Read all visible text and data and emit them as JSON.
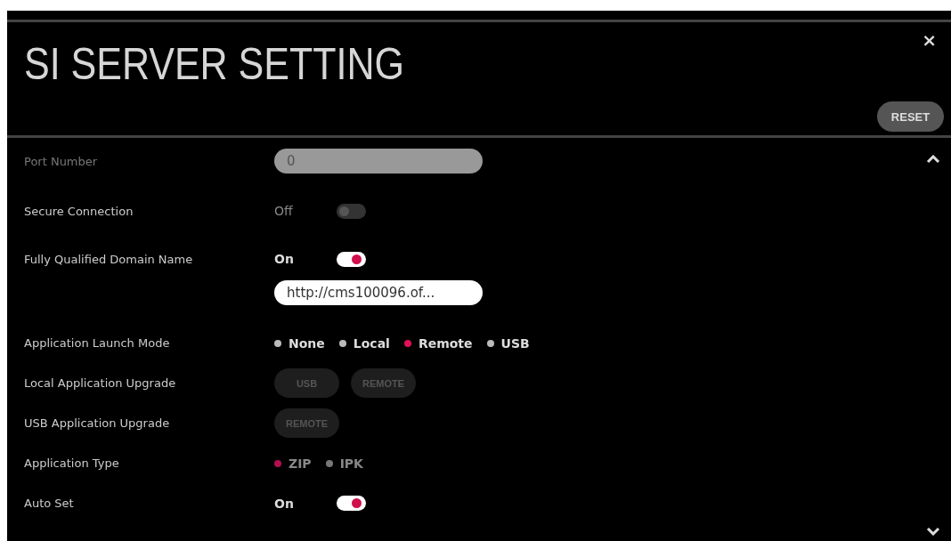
{
  "window": {
    "title": "SI SERVER SETTING",
    "close": "×"
  },
  "reset_button": {
    "label": "RESET"
  },
  "settings": [
    {
      "kind": "field",
      "label": "Port Number",
      "value": "0",
      "disabled": true
    },
    {
      "kind": "toggle",
      "label": "Secure Connection",
      "state_text": "Off",
      "on": false,
      "disabled": true
    },
    {
      "kind": "toggle",
      "label": "Fully Qualified Domain Name",
      "state_text": "On",
      "on": true,
      "url": "http://cms100096.of..."
    },
    {
      "kind": "radio",
      "label": "Application Launch Mode",
      "disabled": false,
      "options": [
        {
          "label": "None",
          "selected": false
        },
        {
          "label": "Local",
          "selected": false
        },
        {
          "label": "Remote",
          "selected": true
        },
        {
          "label": "USB",
          "selected": false
        }
      ]
    },
    {
      "kind": "buttons",
      "label": "Local Application Upgrade",
      "disabled": true,
      "buttons": [
        "USB",
        "REMOTE"
      ]
    },
    {
      "kind": "buttons",
      "label": "USB Application Upgrade",
      "disabled": true,
      "buttons": [
        "REMOTE"
      ]
    },
    {
      "kind": "radio",
      "label": "Application Type",
      "disabled": true,
      "options": [
        {
          "label": "ZIP",
          "selected": true
        },
        {
          "label": "IPK",
          "selected": false
        }
      ]
    },
    {
      "kind": "toggle",
      "label": "Auto Set",
      "state_text": "On",
      "on": true
    }
  ]
}
